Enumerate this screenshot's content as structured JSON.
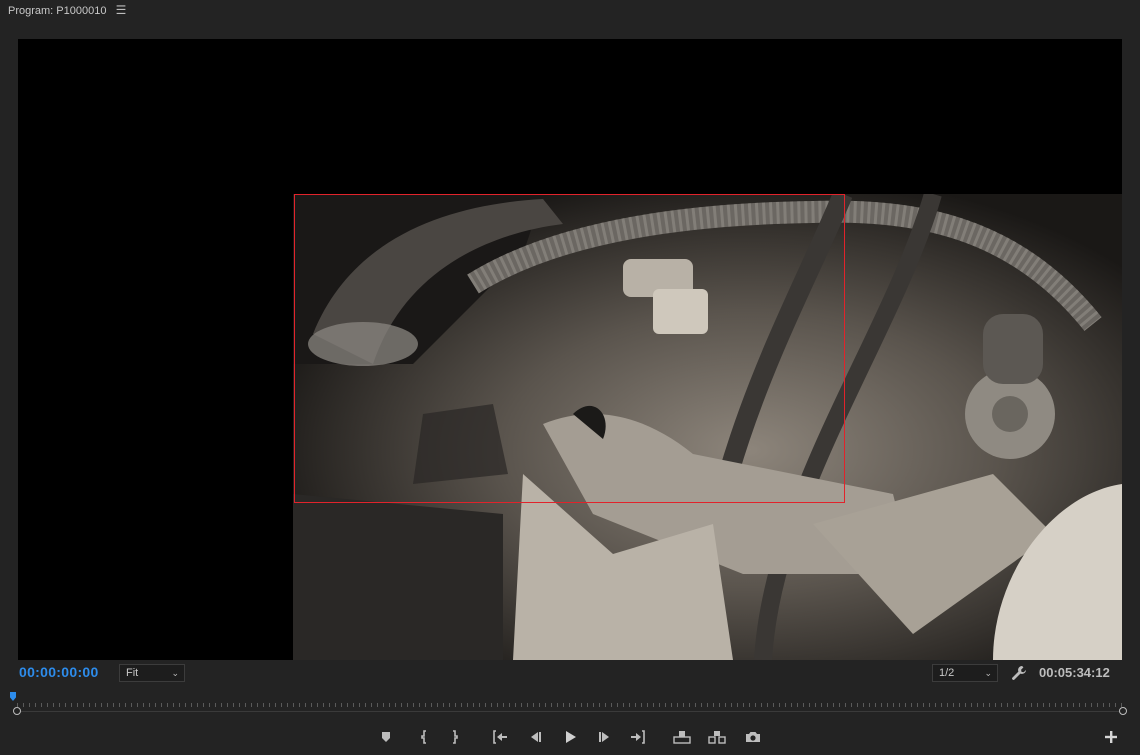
{
  "panel": {
    "title": "Program: P1000010",
    "menu_icon": "hamburger-menu-icon"
  },
  "viewer": {
    "frame_description_colors": {
      "background": "#000000",
      "safe_margin_color": "#e1232b"
    }
  },
  "controls": {
    "current_timecode": "00:00:00:00",
    "zoom_select": "Fit",
    "resolution_select": "1/2",
    "duration_timecode": "00:05:34:12",
    "settings_icon": "wrench-icon"
  },
  "transport": {
    "buttons": [
      "add-marker-icon",
      "mark-in-icon",
      "mark-out-icon",
      "go-to-in-icon",
      "step-back-icon",
      "play-icon",
      "step-forward-icon",
      "go-to-out-icon",
      "lift-icon",
      "extract-icon",
      "export-frame-icon"
    ],
    "add_button_icon": "plus-icon"
  },
  "colors": {
    "panel_bg": "#232323",
    "accent_timecode": "#2d8ceb",
    "text": "#bdbdbd"
  }
}
